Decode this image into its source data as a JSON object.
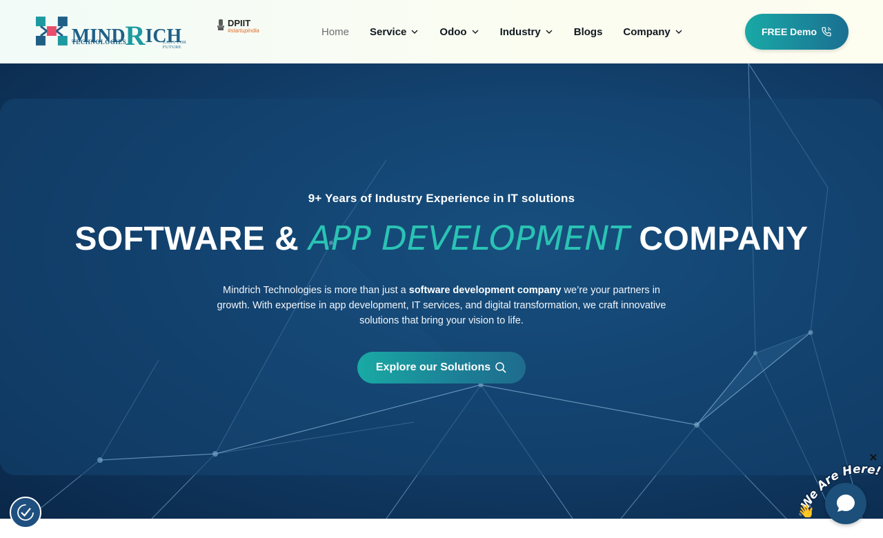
{
  "brand": {
    "logo_main_left": "MIND",
    "logo_main_r": "R",
    "logo_main_right": "ICH",
    "logo_sub": "TECHNOLOGIES",
    "logo_tagline": "EADY FOR FUTURE",
    "dpiit_title": "DPIIT",
    "dpiit_sub": "#startupindia"
  },
  "nav": {
    "items": [
      {
        "label": "Home",
        "active": true,
        "dropdown": false
      },
      {
        "label": "Service",
        "active": false,
        "dropdown": true
      },
      {
        "label": "Odoo",
        "active": false,
        "dropdown": true
      },
      {
        "label": "Industry",
        "active": false,
        "dropdown": true
      },
      {
        "label": "Blogs",
        "active": false,
        "dropdown": false
      },
      {
        "label": "Company",
        "active": false,
        "dropdown": true
      }
    ],
    "demo_label": "FREE Demo"
  },
  "hero": {
    "tagline": "9+ Years of Industry Experience in IT solutions",
    "title_part1": "SOFTWARE & ",
    "title_accent": "APP DEVELOPMENT",
    "title_part2": " COMPANY",
    "desc_part1": "Mindrich Technologies is more than just a ",
    "desc_bold": "software development company",
    "desc_part2": " we’re your partners in growth. With expertise in app development, IT services, and digital transformation, we craft innovative solutions that bring your vision to life.",
    "cta_label": "Explore our Solutions"
  },
  "chat": {
    "bubble_text": "We Are Here!"
  },
  "colors": {
    "accent": "#2ac3b4",
    "brand_blue": "#1f5f86",
    "hero_bg": "#123f6b"
  },
  "icons": {
    "demo": "phone-icon",
    "cta": "search-icon",
    "accessibility": "accessibility-icon",
    "chat": "chat-icon",
    "close": "close-icon"
  }
}
